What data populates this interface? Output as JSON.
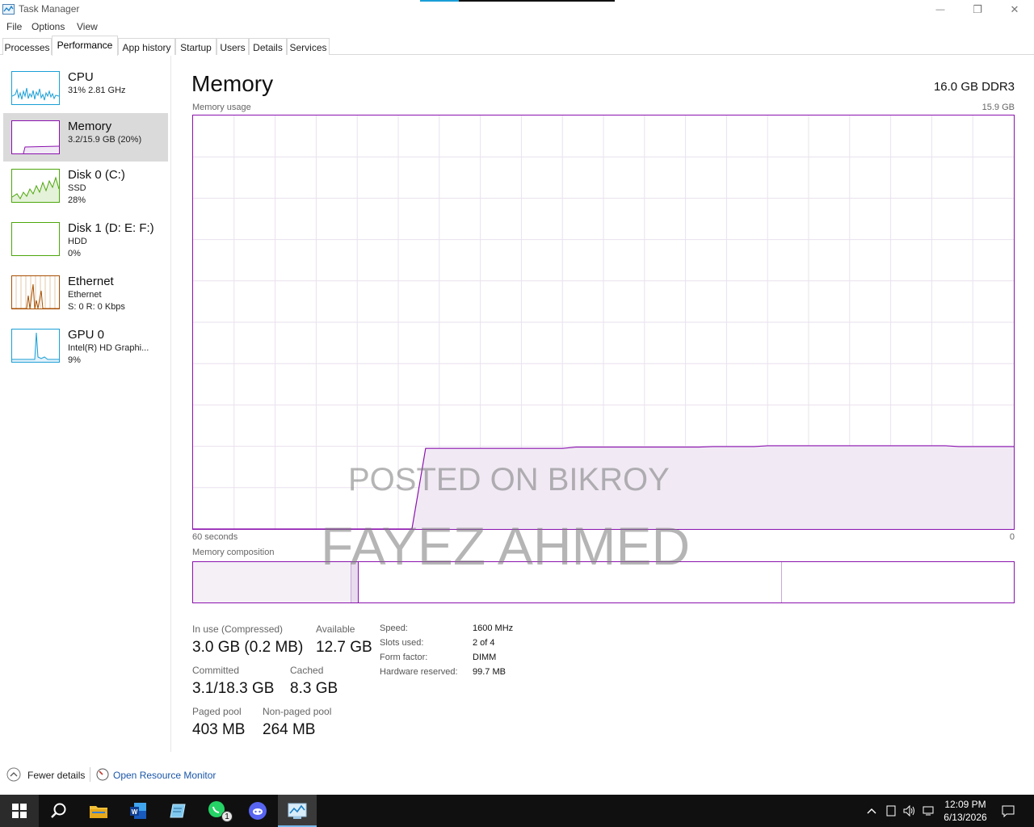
{
  "window": {
    "title": "Task Manager",
    "minimize_label": "—",
    "restore_label": "❐",
    "close_label": "✕"
  },
  "menu": [
    "File",
    "Options",
    "View"
  ],
  "tabs": [
    {
      "label": "Processes",
      "active": false
    },
    {
      "label": "Performance",
      "active": true
    },
    {
      "label": "App history",
      "active": false
    },
    {
      "label": "Startup",
      "active": false
    },
    {
      "label": "Users",
      "active": false
    },
    {
      "label": "Details",
      "active": false
    },
    {
      "label": "Services",
      "active": false
    }
  ],
  "sidebar": {
    "items": [
      {
        "name": "CPU",
        "line1": "31% 2.81 GHz",
        "line2": "",
        "color": "#1a9fd6"
      },
      {
        "name": "Memory",
        "line1": "3.2/15.9 GB (20%)",
        "line2": "",
        "color": "#8b12ae"
      },
      {
        "name": "Disk 0 (C:)",
        "line1": "SSD",
        "line2": "28%",
        "color": "#4da60c"
      },
      {
        "name": "Disk 1 (D: E: F:)",
        "line1": "HDD",
        "line2": "0%",
        "color": "#4da60c"
      },
      {
        "name": "Ethernet",
        "line1": "Ethernet",
        "line2": "S: 0 R: 0 Kbps",
        "color": "#a74f01"
      },
      {
        "name": "GPU 0",
        "line1": "Intel(R) HD Graphi...",
        "line2": "9%",
        "color": "#1a9fd6"
      }
    ]
  },
  "main": {
    "title": "Memory",
    "spec": "16.0 GB DDR3",
    "usage_label": "Memory usage",
    "usage_max": "15.9 GB",
    "time_left": "60 seconds",
    "time_right": "0",
    "composition_label": "Memory composition",
    "accent_color": "#8b12ae",
    "stats": {
      "in_use_label": "In use (Compressed)",
      "in_use_value": "3.0 GB (0.2 MB)",
      "available_label": "Available",
      "available_value": "12.7 GB",
      "committed_label": "Committed",
      "committed_value": "3.1/18.3 GB",
      "cached_label": "Cached",
      "cached_value": "8.3 GB",
      "paged_label": "Paged pool",
      "paged_value": "403 MB",
      "nonpaged_label": "Non-paged pool",
      "nonpaged_value": "264 MB"
    },
    "specs": [
      {
        "label": "Speed:",
        "value": "1600 MHz"
      },
      {
        "label": "Slots used:",
        "value": "2 of 4"
      },
      {
        "label": "Form factor:",
        "value": "DIMM"
      },
      {
        "label": "Hardware reserved:",
        "value": "99.7 MB"
      }
    ]
  },
  "watermark": {
    "line1": "POSTED ON BIKROY",
    "line2": "FAYEZ AHMED"
  },
  "footer": {
    "fewer_details": "Fewer details",
    "resource_monitor": "Open Resource Monitor"
  },
  "chart_data": {
    "type": "area",
    "title": "Memory usage",
    "xlabel": "",
    "ylabel": "",
    "x_range_seconds": [
      60,
      0
    ],
    "ylim": [
      0,
      15.9
    ],
    "grid": true,
    "series": [
      {
        "values": [
          0,
          0,
          0,
          0,
          0,
          0,
          0,
          0,
          0,
          0,
          0,
          0,
          0,
          0,
          0,
          0,
          0,
          3.1,
          3.1,
          3.1,
          3.1,
          3.1,
          3.1,
          3.1,
          3.1,
          3.1,
          3.1,
          3.1,
          3.15,
          3.15,
          3.15,
          3.15,
          3.15,
          3.15,
          3.15,
          3.15,
          3.15,
          3.15,
          3.17,
          3.17,
          3.17,
          3.17,
          3.2,
          3.2,
          3.2,
          3.2,
          3.2,
          3.2,
          3.2,
          3.2,
          3.2,
          3.2,
          3.2,
          3.2,
          3.2,
          3.2,
          3.17,
          3.17,
          3.17,
          3.17,
          3.17
        ]
      }
    ]
  },
  "taskbar": {
    "clock_time": "12:09 PM",
    "clock_date": "6/13/2026",
    "whatsapp_badge": "1"
  }
}
